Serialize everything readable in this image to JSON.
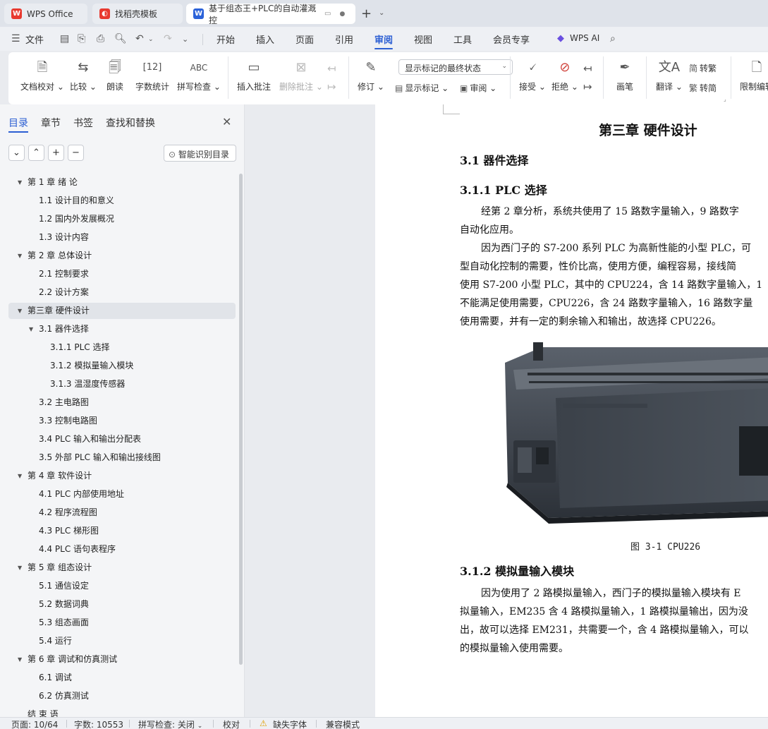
{
  "window": {
    "tabs": [
      {
        "label": "WPS Office",
        "icon": "wps-logo-icon"
      },
      {
        "label": "找稻壳模板",
        "icon": "docer-icon"
      },
      {
        "label": "基于组态王+PLC的自动灌溉控",
        "icon": "writer-icon"
      }
    ]
  },
  "menu": {
    "file": "文件",
    "items": [
      "开始",
      "插入",
      "页面",
      "引用",
      "审阅",
      "视图",
      "工具",
      "会员专享"
    ],
    "active": "审阅",
    "ai": "WPS AI"
  },
  "ribbon": {
    "doc_check": "文档校对",
    "compare": "比较",
    "read_aloud": "朗读",
    "word_count": "字数统计",
    "spell_check": "拼写检查",
    "insert_comment": "插入批注",
    "delete_comment": "删除批注",
    "track_changes": "修订",
    "markup_mode": "显示标记的最终状态",
    "show_markup": "显示标记",
    "review": "审阅",
    "accept": "接受",
    "reject": "拒绝",
    "pen": "画笔",
    "translate": "翻译",
    "to_traditional": "转繁",
    "to_simplified": "转简",
    "restrict_edit": "限制编辑"
  },
  "sidebar": {
    "tabs": [
      "目录",
      "章节",
      "书签",
      "查找和替换"
    ],
    "smart_toc": "智能识别目录",
    "toc": [
      {
        "label": "第 1 章  绪  论",
        "level": 1,
        "expanded": true
      },
      {
        "label": "1.1  设计目的和意义",
        "level": 2
      },
      {
        "label": "1.2  国内外发展概况",
        "level": 2
      },
      {
        "label": "1.3  设计内容",
        "level": 2
      },
      {
        "label": "第 2 章  总体设计",
        "level": 1,
        "expanded": true
      },
      {
        "label": "2.1  控制要求",
        "level": 2
      },
      {
        "label": "2.2    设计方案",
        "level": 2
      },
      {
        "label": "第三章  硬件设计",
        "level": 1,
        "expanded": true,
        "selected": true
      },
      {
        "label": "3.1 器件选择",
        "level": 2,
        "expanded": true
      },
      {
        "label": "3.1.1 PLC 选择",
        "level": 3
      },
      {
        "label": "3.1.2  模拟量输入模块",
        "level": 3
      },
      {
        "label": "3.1.3  温湿度传感器",
        "level": 3
      },
      {
        "label": "3.2 主电路图",
        "level": 2
      },
      {
        "label": "3.3 控制电路图",
        "level": 2
      },
      {
        "label": "3.4 PLC 输入和输出分配表",
        "level": 2
      },
      {
        "label": "3.5  外部 PLC 输入和输出接线图",
        "level": 2
      },
      {
        "label": "第 4 章  软件设计",
        "level": 1,
        "expanded": true
      },
      {
        "label": "4.1 PLC 内部使用地址",
        "level": 2
      },
      {
        "label": "4.2  程序流程图",
        "level": 2
      },
      {
        "label": "4.3  PLC 梯形图",
        "level": 2
      },
      {
        "label": "4.4 PLC 语句表程序",
        "level": 2
      },
      {
        "label": "第 5 章  组态设计",
        "level": 1,
        "expanded": true
      },
      {
        "label": "5.1  通信设定",
        "level": 2
      },
      {
        "label": "5.2 数据词典",
        "level": 2
      },
      {
        "label": "5.3 组态画面",
        "level": 2
      },
      {
        "label": "5.4 运行",
        "level": 2
      },
      {
        "label": "第 6 章  调试和仿真测试",
        "level": 1,
        "expanded": true
      },
      {
        "label": "6.1  调试",
        "level": 2
      },
      {
        "label": "6.2  仿真测试",
        "level": 2
      },
      {
        "label": "结  束  语",
        "level": 1
      }
    ]
  },
  "document": {
    "chapter_title": "第三章  硬件设计",
    "section_3_1": "3.1 器件选择",
    "section_3_1_1": "3.1.1 PLC 选择",
    "p1_line1": "经第 2 章分析，系统共使用了 15 路数字量输入，9 路数字",
    "p1_line2": "自动化应用。",
    "p2_line1": "因为西门子的 S7-200 系列 PLC 为高新性能的小型 PLC，可",
    "p2_line2": "型自动化控制的需要，性价比高，使用方便，编程容易，接线简",
    "p2_line3": "使用 S7-200 小型 PLC，其中的 CPU224，含 14 路数字量输入，1",
    "p2_line4": "不能满足使用需要，CPU226，含 24 路数字量输入，16 路数字量",
    "p2_line5": "使用需要，并有一定的剩余输入和输出，故选择 CPU226。",
    "figure_caption": "图 3-1 CPU226",
    "section_3_1_2": "3.1.2  模拟量输入模块",
    "p3_line1": "因为使用了 2 路模拟量输入，西门子的模拟量输入模块有 E",
    "p3_line2": "拟量输入，EM235 含 4 路模拟量输入，1 路模拟量输出，因为没",
    "p3_line3": "出，故可以选择 EM231，共需要一个，含 4 路模拟量输入，可以",
    "p3_line4": "的模拟量输入使用需要。"
  },
  "status": {
    "page": "页面: 10/64",
    "words": "字数: 10553",
    "spell": "拼写检查: 关闭",
    "proof": "校对",
    "missing_font": "缺失字体",
    "compat": "兼容模式"
  },
  "colors": {
    "accent": "#2c5fd3",
    "wps_red": "#e8392f",
    "writer_blue": "#2b62d9"
  }
}
